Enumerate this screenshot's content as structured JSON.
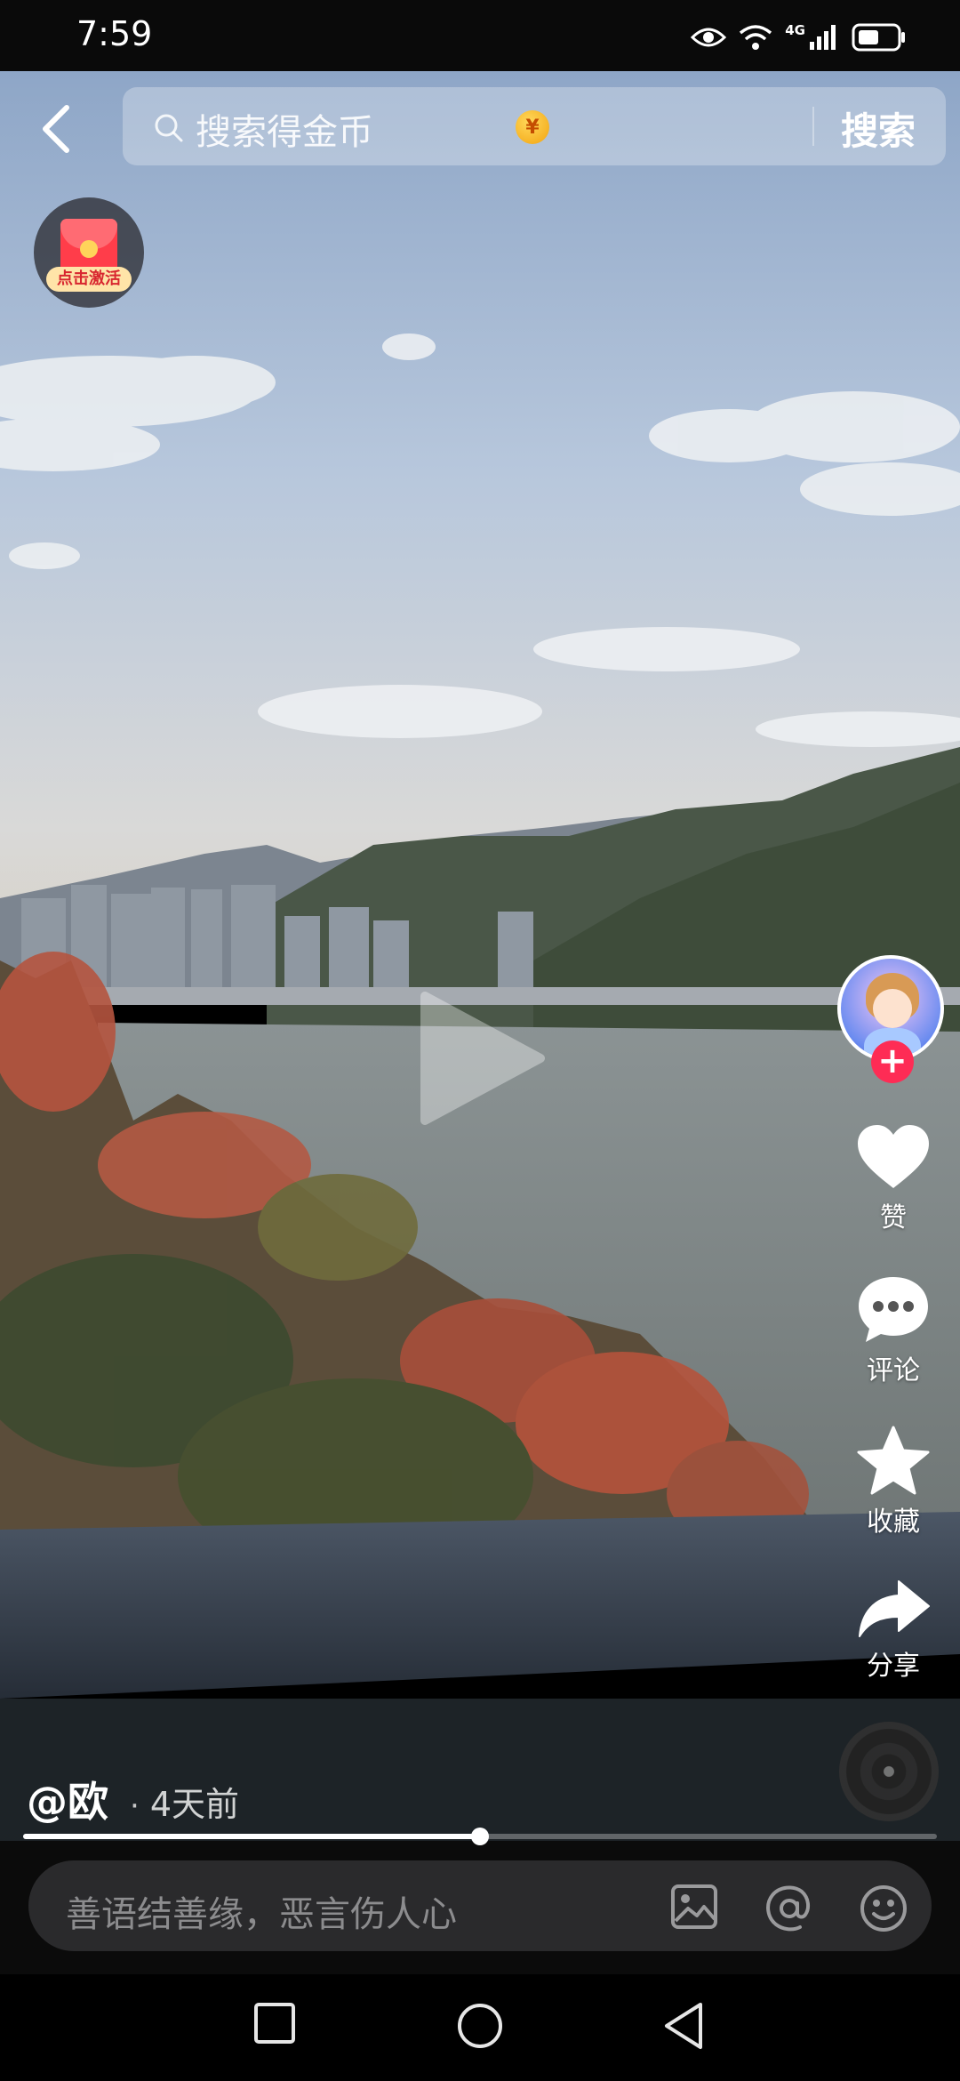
{
  "status_bar": {
    "time": "7:59",
    "network": "4G",
    "icons": [
      "eye-icon",
      "wifi-icon",
      "signal-icon",
      "battery-icon"
    ]
  },
  "search": {
    "placeholder": "搜索得金币",
    "coin_symbol": "¥",
    "button_label": "搜索"
  },
  "red_packet": {
    "label": "点击激活"
  },
  "actions": {
    "like_label": "赞",
    "comment_label": "评论",
    "favorite_label": "收藏",
    "share_label": "分享",
    "follow_symbol": "+"
  },
  "post": {
    "author": "@欧",
    "separator": "·",
    "time": "4天前"
  },
  "playback": {
    "progress": 0.5
  },
  "comment_bar": {
    "placeholder": "善语结善缘，恶言伤人心"
  },
  "colors": {
    "accent_red": "#fe2c55",
    "coin_gold": "#f2a30f"
  }
}
